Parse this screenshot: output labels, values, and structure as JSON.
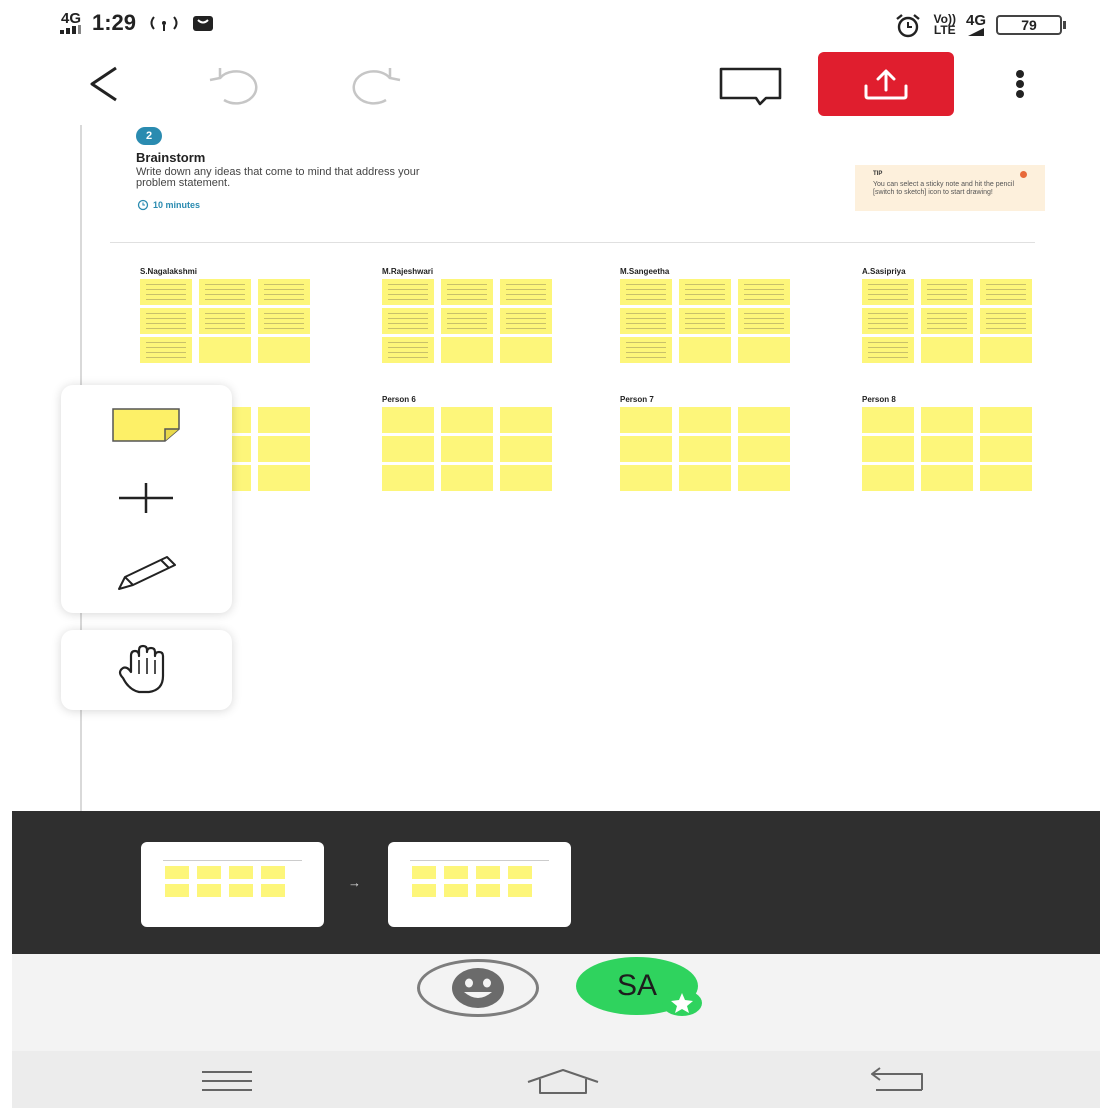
{
  "status_bar": {
    "network_left": "4G",
    "time": "1:29",
    "network_right": "4G",
    "volte_label": "Vo))",
    "lte_label": "LTE",
    "battery": "79"
  },
  "toolbar": {
    "back_icon": "back-chevron-icon",
    "undo_icon": "undo-icon",
    "redo_icon": "redo-icon",
    "comment_icon": "comment-icon",
    "share_icon": "share-upload-icon",
    "more_icon": "more-vertical-icon",
    "share_color": "#e01e2e"
  },
  "brainstorm": {
    "step": "2",
    "title": "Brainstorm",
    "description": "Write down any ideas that come to mind that address your problem statement.",
    "time": "10 minutes",
    "tip_label": "TIP",
    "tip_text": "You can select a sticky note and hit the pencil [switch to sketch] icon to start drawing!"
  },
  "persons_row1": [
    {
      "name": "S.Nagalakshmi"
    },
    {
      "name": "M.Rajeshwari"
    },
    {
      "name": "M.Sangeetha"
    },
    {
      "name": "A.Sasipriya"
    }
  ],
  "persons_row2": [
    {
      "name": ""
    },
    {
      "name": "Person 6"
    },
    {
      "name": "Person 7"
    },
    {
      "name": "Person 8"
    }
  ],
  "palette": {
    "tools": [
      "sticky-note-icon",
      "plus-icon",
      "pencil-icon"
    ],
    "hand_tool": "hand-icon",
    "sticky_color": "#fdf067"
  },
  "presence": {
    "avatar_initials": "SA",
    "avatar_color": "#2fd35e"
  },
  "nav": {
    "menu_icon": "menu-icon",
    "home_icon": "home-icon",
    "back_icon": "nav-back-icon"
  }
}
